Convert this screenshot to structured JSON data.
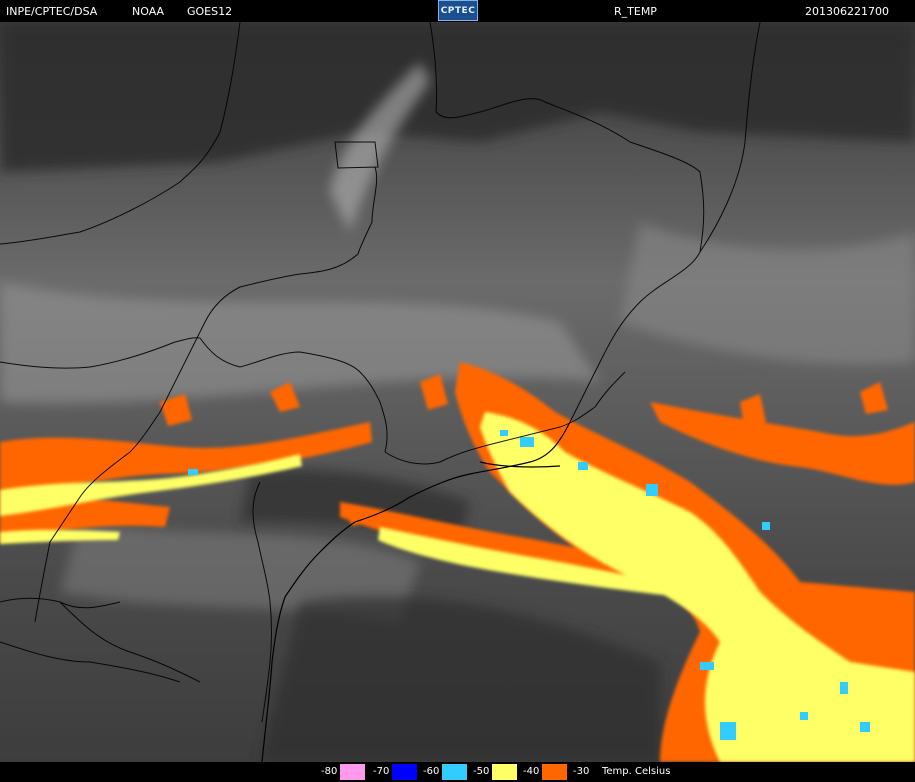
{
  "header": {
    "agency": "INPE/CPTEC/DSA",
    "source": "NOAA",
    "satellite": "GOES12",
    "logo_text": "CPTEC",
    "product": "R_TEMP",
    "timestamp": "201306221700"
  },
  "legend": {
    "units": "Temp. Celsius",
    "items": [
      {
        "label": "-80",
        "color": "#ff99ee"
      },
      {
        "label": "-70",
        "color": "#0000ff"
      },
      {
        "label": "-60",
        "color": "#33ccff"
      },
      {
        "label": "-50",
        "color": "#ffff66"
      },
      {
        "label": "-40",
        "color": "#ff6600"
      },
      {
        "label": "-30",
        "color": "#000000"
      }
    ]
  }
}
